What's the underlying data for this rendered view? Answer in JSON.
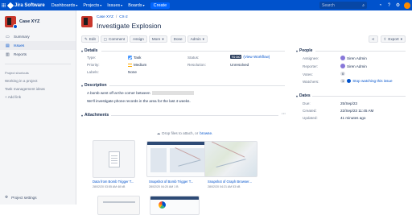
{
  "topbar": {
    "brand": "Jira Software",
    "nav": [
      "Dashboards",
      "Projects",
      "Issues",
      "Boards"
    ],
    "create": "Create",
    "search_placeholder": "Search"
  },
  "sidebar": {
    "project_name": "Case XYZ",
    "items": [
      {
        "label": "Summary",
        "icon": "summary-icon"
      },
      {
        "label": "Issues",
        "icon": "issues-icon"
      },
      {
        "label": "Reports",
        "icon": "reports-icon"
      }
    ],
    "plain": [
      "Project shortcuts",
      "Working in a project",
      "Task management ideas"
    ],
    "add_link": "Add link",
    "footer": "Project settings"
  },
  "issue": {
    "breadcrumb_project": "Case XYZ",
    "breadcrumb_sep": "/",
    "breadcrumb_key": "CX-2",
    "title": "Investigate Explosion",
    "toolbar": [
      "Edit",
      "Comment",
      "Assign",
      "More",
      "Done",
      "Admin"
    ],
    "export": "Export"
  },
  "details": {
    "heading": "Details",
    "type_label": "Type:",
    "type_value": "Task",
    "priority_label": "Priority:",
    "priority_value": "Medium",
    "labels_label": "Labels:",
    "labels_value": "None",
    "status_label": "Status:",
    "status_value": "TO DO",
    "workflow_link": "(View Workflow)",
    "resolution_label": "Resolution:",
    "resolution_value": "Unresolved"
  },
  "description": {
    "heading": "Description",
    "line1": "A bomb went off at the corner between",
    "line2": "We'll investigate phone records in the area for the last 4 weeks."
  },
  "attachments": {
    "heading": "Attachments",
    "drop_text": "Drop files to attach, or",
    "browse": "browse.",
    "files": [
      {
        "name": "Data from Bomb Trigger T...",
        "meta": "28/02/20 03:55 AM  48 kB"
      },
      {
        "name": "Snapshot of Bomb Trigger T...",
        "meta": "28/02/20 04:20 AM  1 B"
      },
      {
        "name": "Snapshot of Graph Browser...",
        "meta": "28/02/20 04:21 AM  53 kB"
      }
    ]
  },
  "people": {
    "heading": "People",
    "assignee_label": "Assignee:",
    "assignee_value": "Siren Admin",
    "reporter_label": "Reporter:",
    "reporter_value": "Siren Admin",
    "votes_label": "Votes:",
    "votes_value": "0",
    "watchers_label": "Watchers:",
    "watchers_value": "1",
    "watch_link": "Stop watching this issue"
  },
  "dates": {
    "heading": "Dates",
    "due_label": "Due:",
    "due_value": "25/Sep/23",
    "created_label": "Created:",
    "created_value": "22/Sep/23 11:45 AM",
    "updated_label": "Updated:",
    "updated_value": "41 minutes ago"
  },
  "colors": {
    "topbar": "#0052cc",
    "link": "#0052cc",
    "status_bg": "#253858",
    "project_icon": "#c9372c"
  }
}
